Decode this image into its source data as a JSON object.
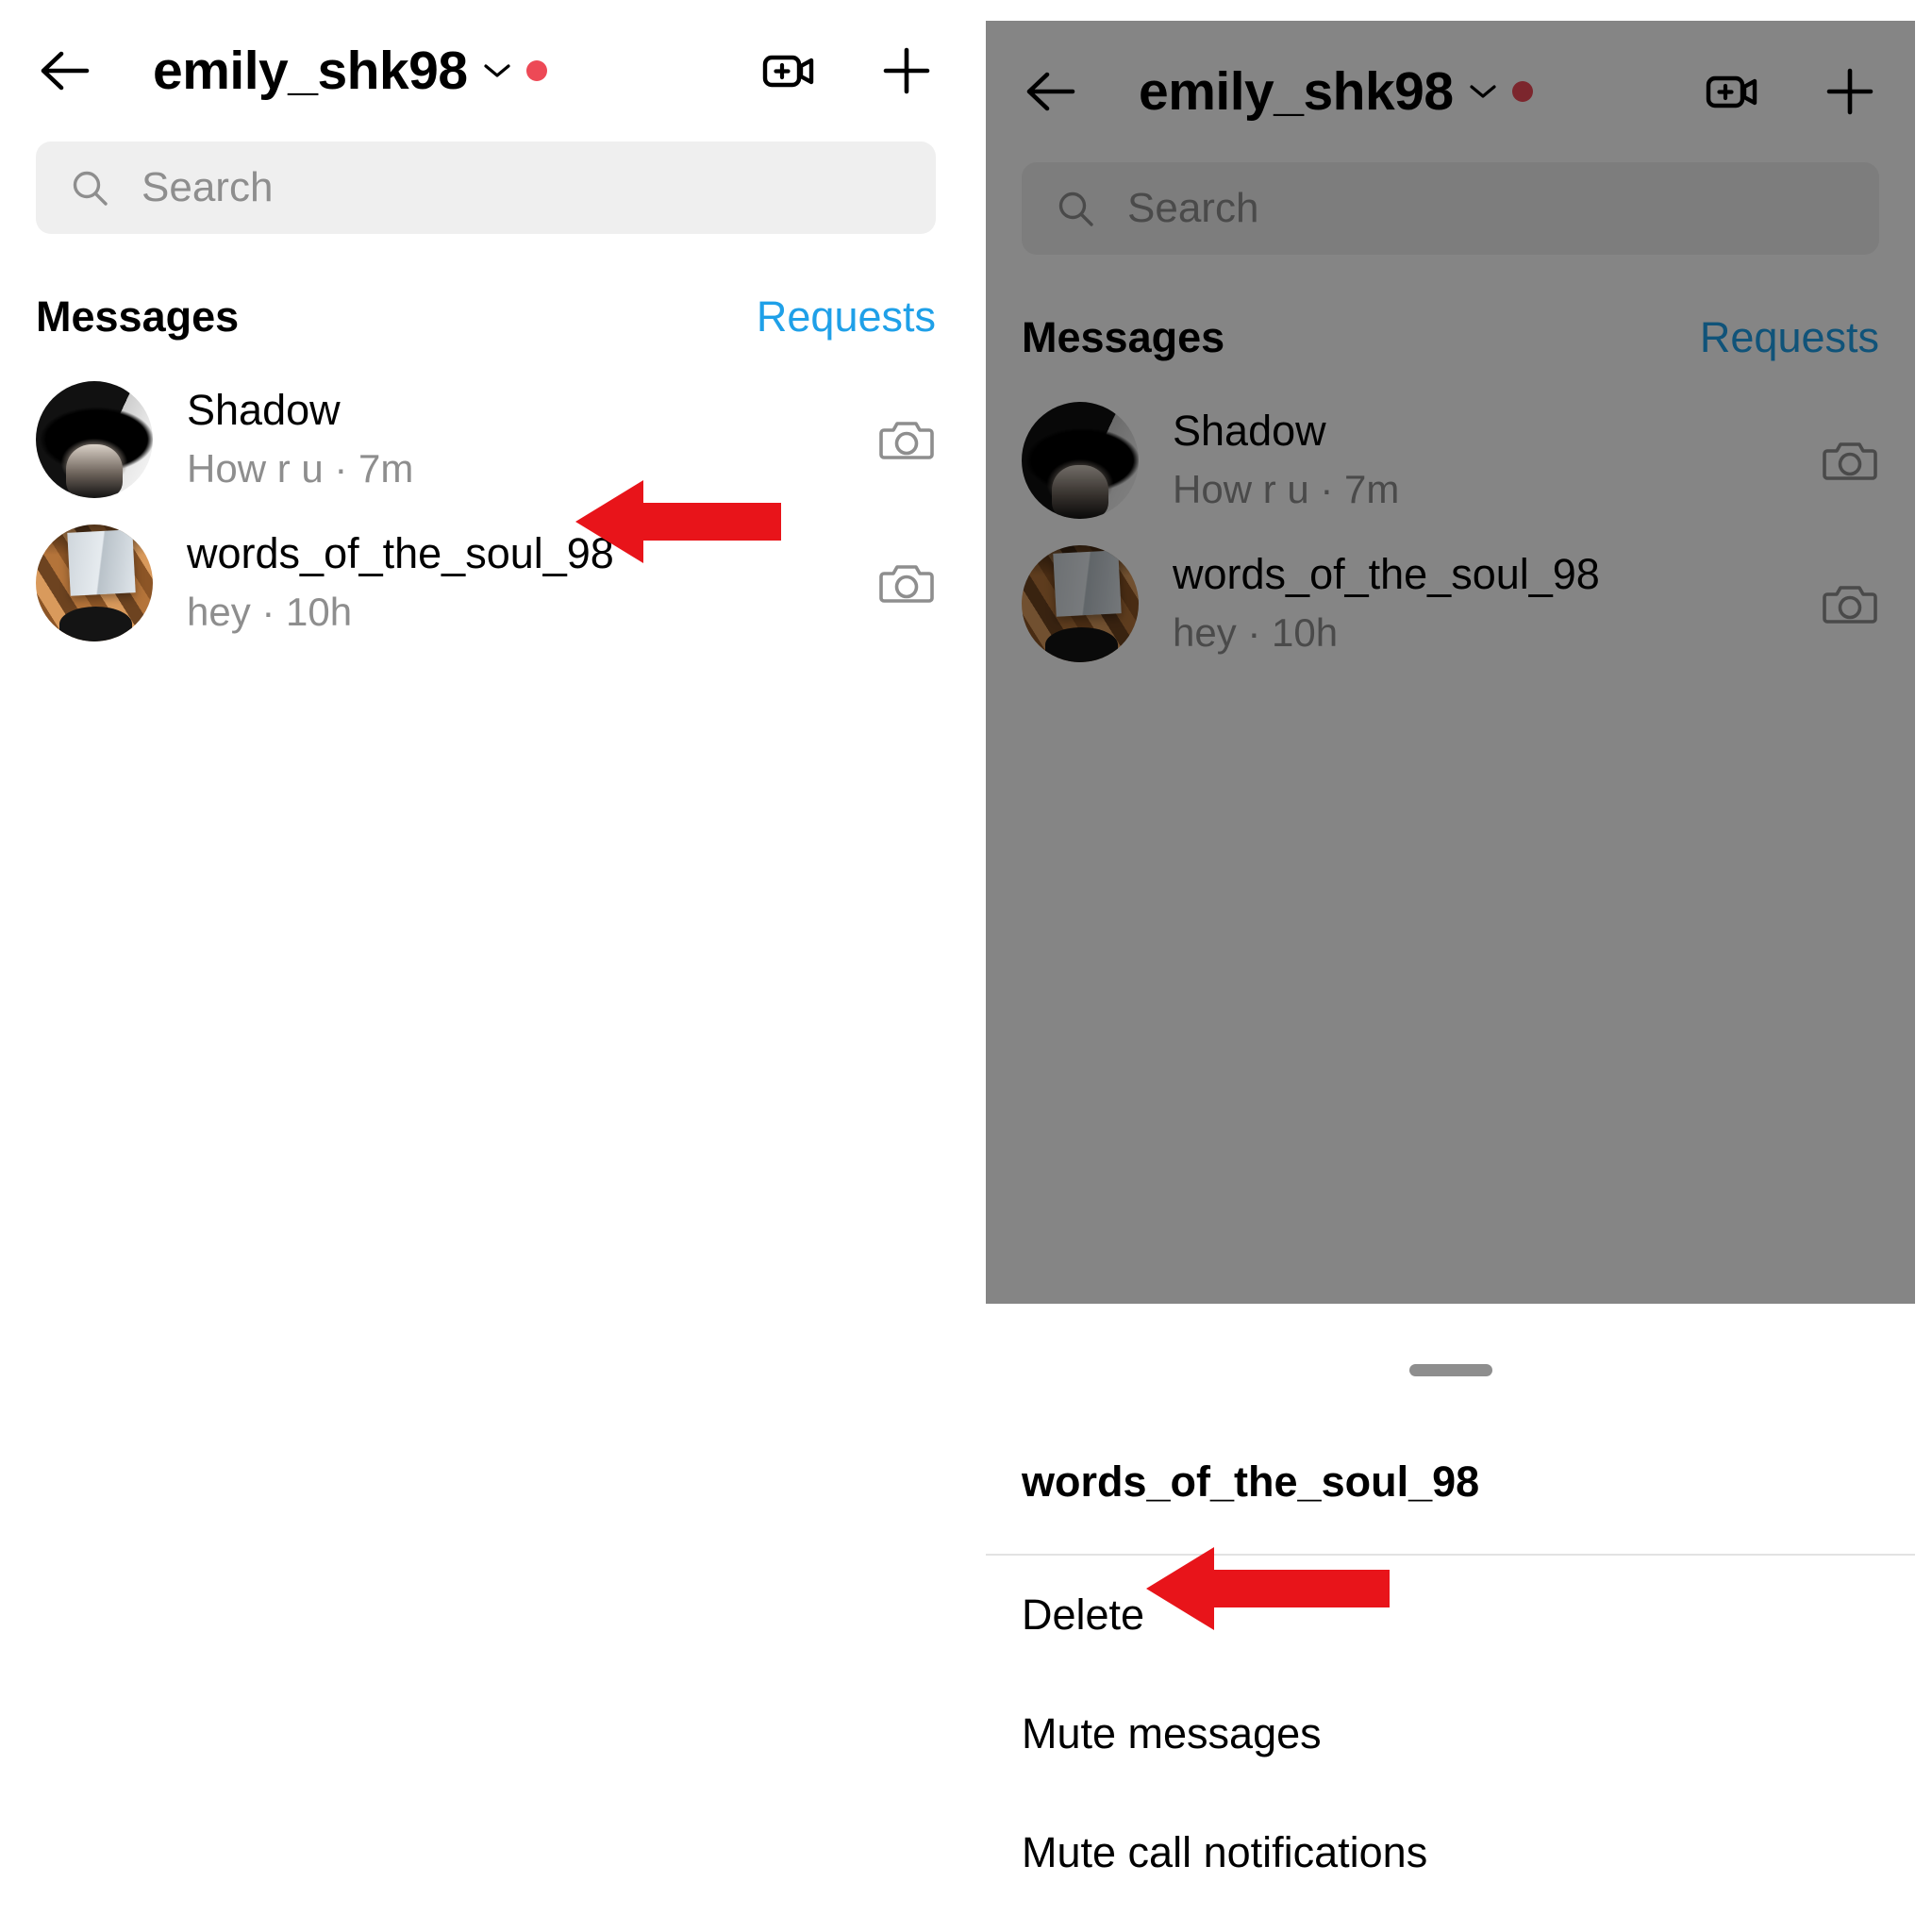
{
  "accent_colors": {
    "link_blue": "#1fa0e8",
    "unread_red_dot": "#ed4956",
    "annotation_red": "#e8141a",
    "dim_overlay": "#808080",
    "search_background": "#efefef",
    "secondary_text": "#8e8e8e"
  },
  "header": {
    "back_icon": "back-arrow-icon",
    "title": "emily_shk98",
    "chevron_icon": "chevron-down-icon",
    "status_dot_icon": "red-status-dot-icon",
    "video_call_icon": "new-video-call-icon",
    "new_message_icon": "plus-new-message-icon"
  },
  "search": {
    "icon": "search-icon",
    "placeholder": "Search",
    "value": ""
  },
  "section": {
    "title": "Messages",
    "requests_label": "Requests"
  },
  "conversations": [
    {
      "avatar": "avatar-person-in-hat",
      "name": "Shadow",
      "preview": "How r u · 7m",
      "camera_icon": "camera-icon"
    },
    {
      "avatar": "avatar-open-book-on-leaves",
      "name": "words_of_the_soul_98",
      "preview": "hey · 10h",
      "camera_icon": "camera-icon"
    }
  ],
  "bottom_sheet": {
    "handle": "drag-handle",
    "title": "words_of_the_soul_98",
    "items": [
      {
        "label": "Delete"
      },
      {
        "label": "Mute messages"
      },
      {
        "label": "Mute call notifications"
      }
    ]
  },
  "annotations": [
    {
      "name": "arrow-pointing-to-shadow-conversation",
      "direction": "left"
    },
    {
      "name": "arrow-pointing-to-delete-option",
      "direction": "left"
    }
  ]
}
